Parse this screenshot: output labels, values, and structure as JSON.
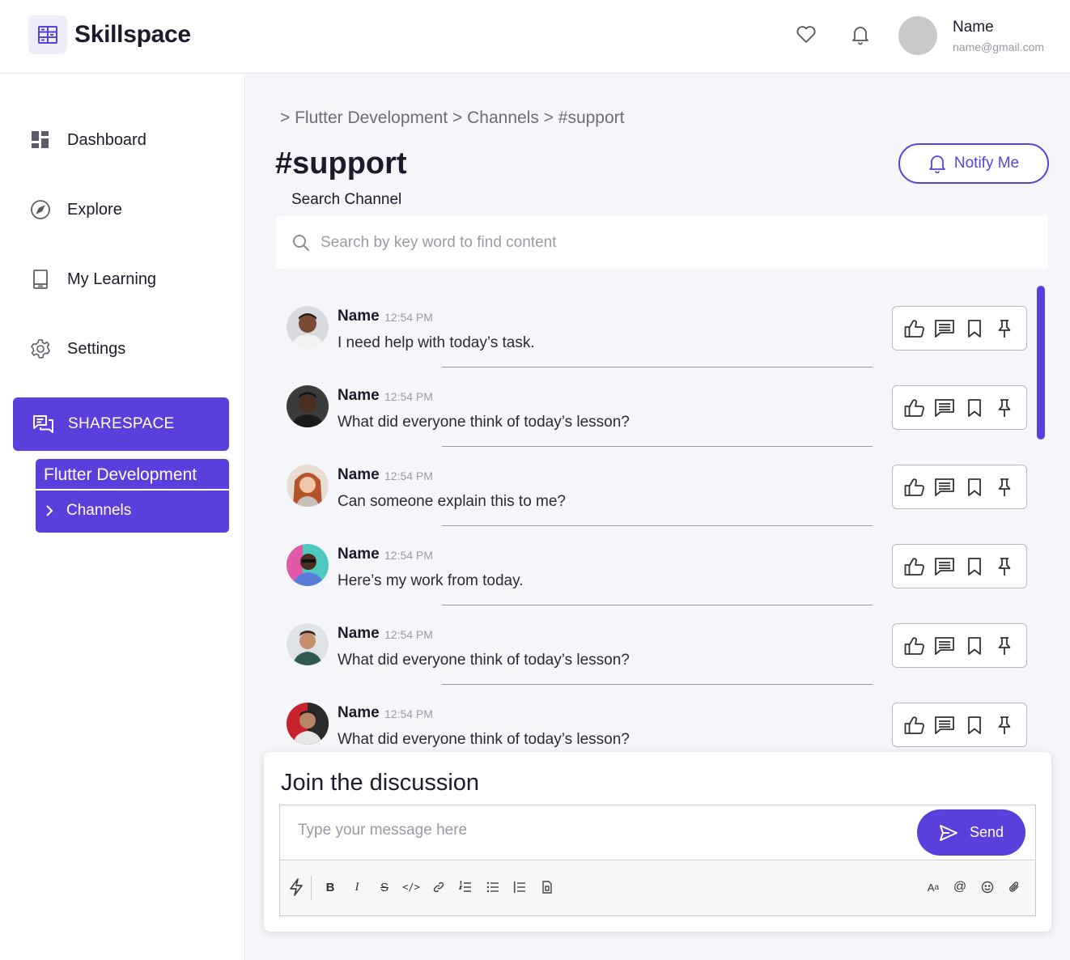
{
  "brand": {
    "name": "Skillspace"
  },
  "header": {
    "user_name": "Name",
    "user_email": "name@gmail.com"
  },
  "sidebar": {
    "items": [
      {
        "label": "Dashboard",
        "icon": "dashboard-icon"
      },
      {
        "label": "Explore",
        "icon": "compass-icon"
      },
      {
        "label": "My Learning",
        "icon": "book-icon"
      },
      {
        "label": "Settings",
        "icon": "gear-icon"
      }
    ],
    "sharespace_label": "SHARESPACE",
    "submenu": {
      "title": "Flutter Development",
      "items": [
        {
          "label": "Channels"
        }
      ]
    }
  },
  "main": {
    "breadcrumb": "> Flutter Development > Channels > #support",
    "title": "#support",
    "notify_label": "Notify Me",
    "search_label": "Search Channel",
    "search_placeholder": "Search by key word to find content"
  },
  "messages": [
    {
      "name": "Name",
      "time": "12:54 PM",
      "text": "I need help with today’s task."
    },
    {
      "name": "Name",
      "time": "12:54 PM",
      "text": "What did everyone think of today’s lesson?"
    },
    {
      "name": "Name",
      "time": "12:54 PM",
      "text": "Can someone explain this to me?"
    },
    {
      "name": "Name",
      "time": "12:54 PM",
      "text": "Here’s my work from today."
    },
    {
      "name": "Name",
      "time": "12:54 PM",
      "text": "What did everyone think of today’s lesson?"
    },
    {
      "name": "Name",
      "time": "12:54 PM",
      "text": "What did everyone think of today’s lesson?"
    }
  ],
  "composer": {
    "title": "Join the discussion",
    "placeholder": "Type your message here",
    "send_label": "Send"
  },
  "colors": {
    "accent": "#5a3fdd",
    "background": "#f5f6fa"
  }
}
